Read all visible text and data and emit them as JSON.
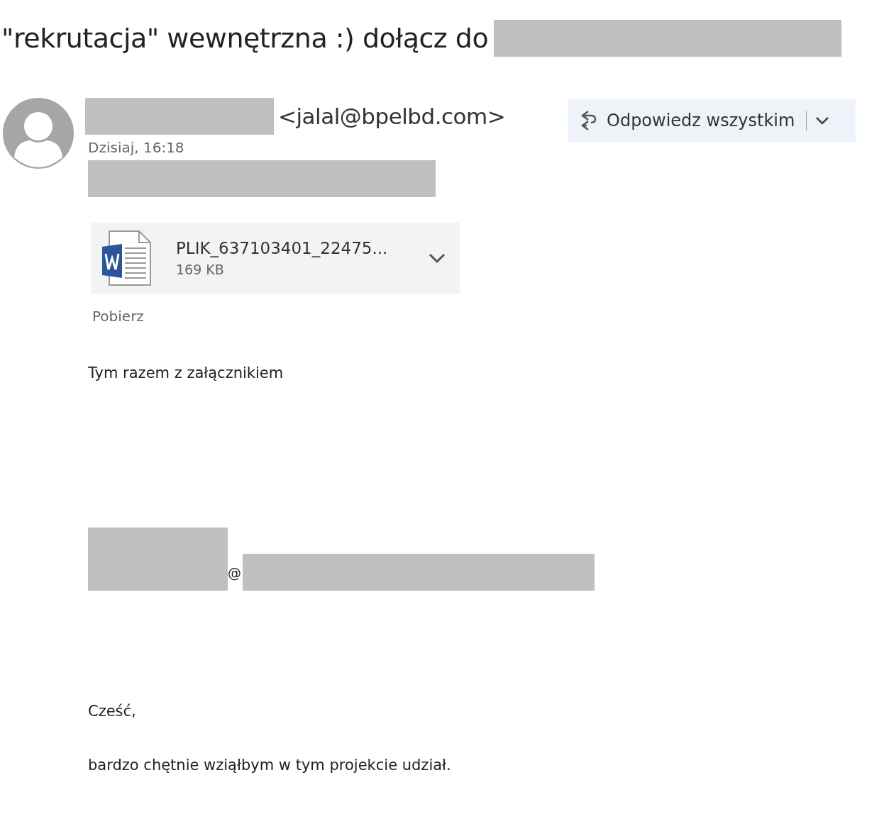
{
  "subject": "\"rekrutacja\" wewnętrzna :) dołącz do",
  "sender": {
    "email": "<jalal@bpelbd.com>",
    "date": "Dzisiaj, 16:18"
  },
  "reply_button": {
    "label": "Odpowiedz wszystkim"
  },
  "attachment": {
    "name": "PLIK_637103401_22475...",
    "size": "169 KB",
    "download": "Pobierz"
  },
  "body": {
    "intro": "Tym razem z załącznikiem",
    "at_sign": "@",
    "greeting": "Cześć,",
    "text": "bardzo chętnie wziąłbym w tym projekcie udział."
  }
}
